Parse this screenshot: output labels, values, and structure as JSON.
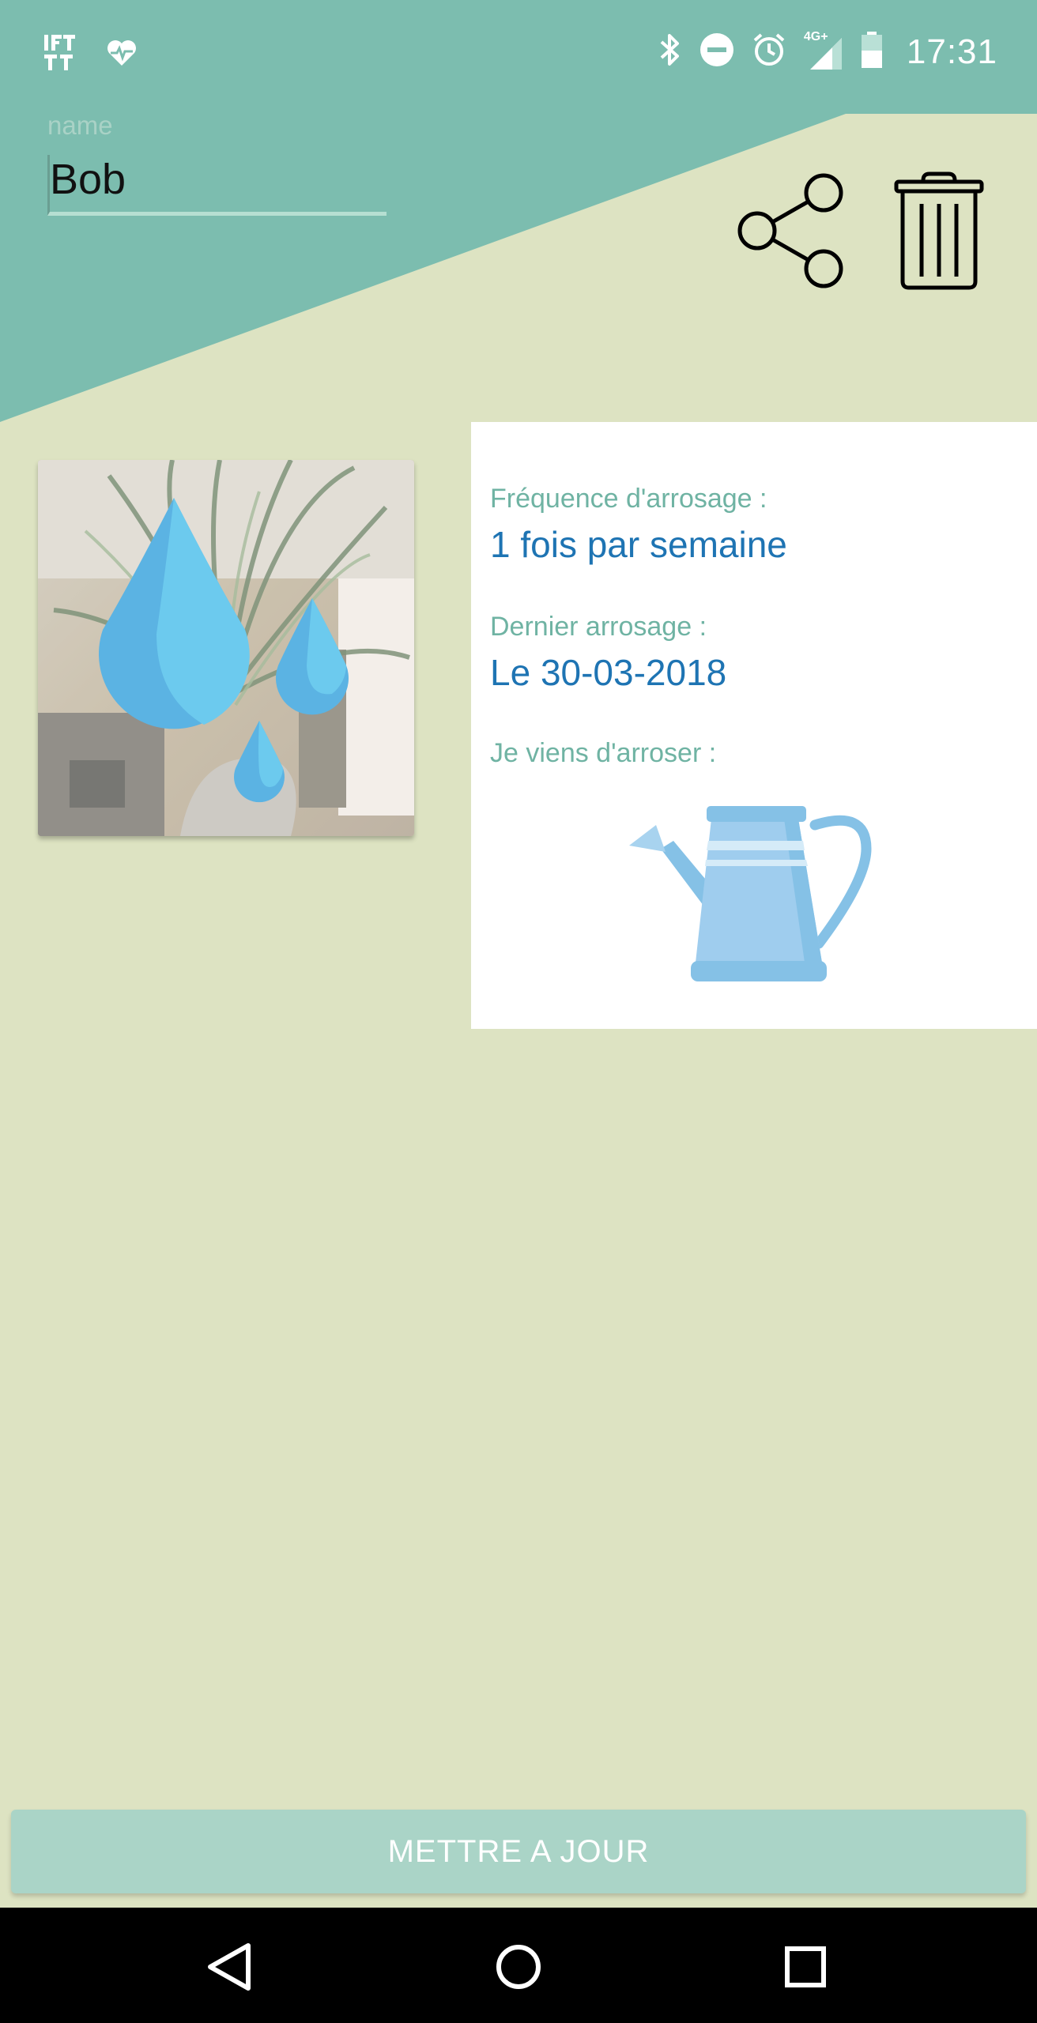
{
  "status_bar": {
    "time": "17:31",
    "network_label": "4G+",
    "left_icons": [
      "ifttt-icon",
      "heart-pulse-icon"
    ],
    "right_icons": [
      "bluetooth-icon",
      "do-not-disturb-icon",
      "alarm-icon",
      "signal-icon",
      "battery-icon"
    ]
  },
  "header": {
    "name_label": "name",
    "name_value": "Bob",
    "actions": [
      "share-icon",
      "trash-icon"
    ]
  },
  "plant": {
    "photo_icon": "water-drops-icon"
  },
  "info": {
    "frequency_label": "Fréquence d'arrosage :",
    "frequency_value": "1 fois par semaine",
    "last_watering_label": "Dernier arrosage :",
    "last_watering_value": "Le 30-03-2018",
    "just_watered_label": "Je viens d'arroser :",
    "just_watered_icon": "watering-can-icon"
  },
  "update_button": {
    "label": "METTRE A JOUR"
  },
  "nav_bar": {
    "buttons": [
      "back-icon",
      "home-icon",
      "recents-icon"
    ]
  },
  "colors": {
    "header_teal": "#7cbdaf",
    "background": "#dde3c2",
    "label_teal": "#6fb3a3",
    "value_blue": "#1e74b3",
    "button": "#aad4c7",
    "drop_blue": "#5bbbe6"
  }
}
